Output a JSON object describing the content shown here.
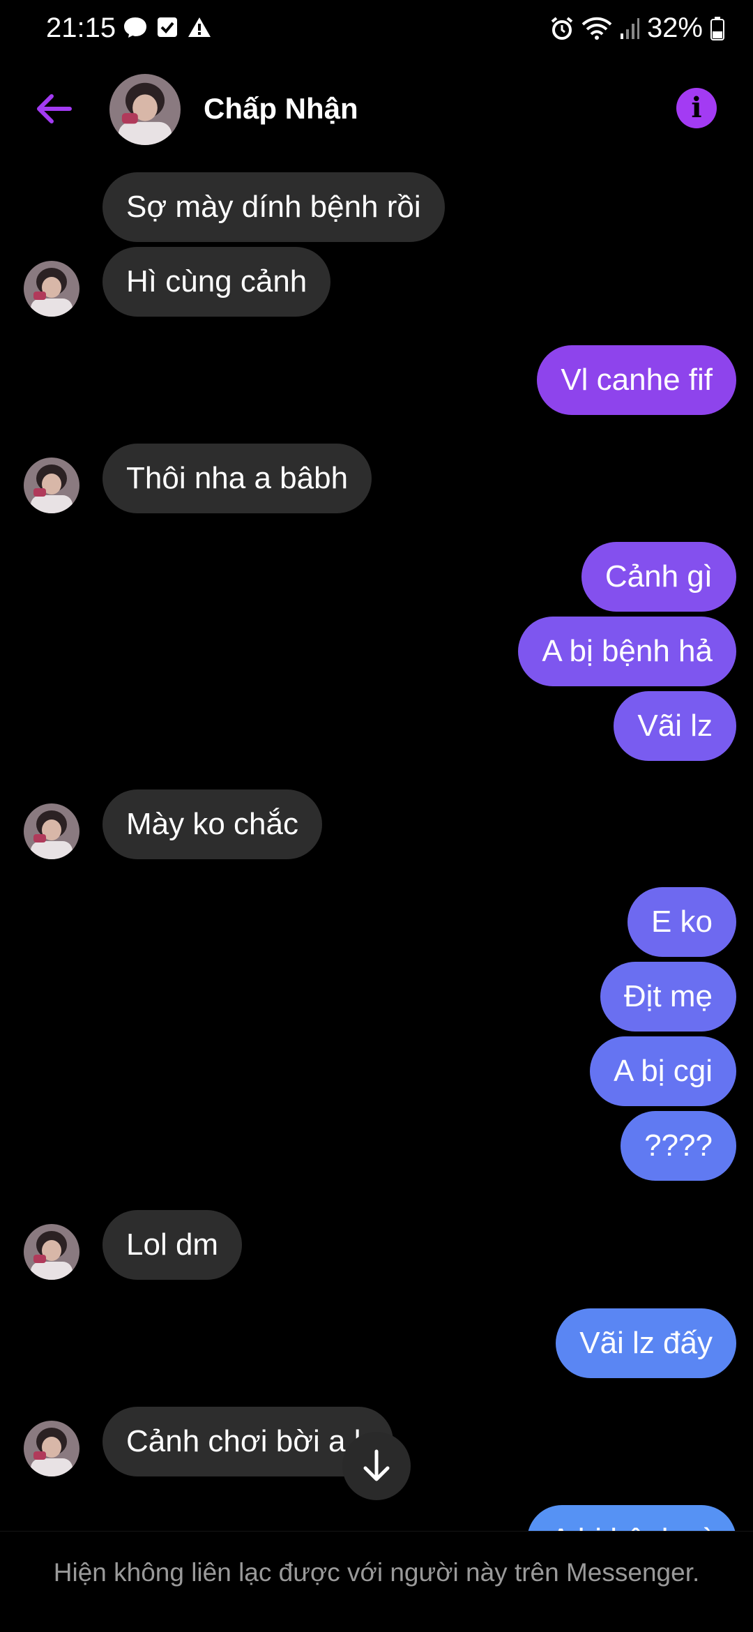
{
  "status_bar": {
    "time": "21:15",
    "battery_percent": "32%",
    "left_icons": [
      "messenger-bubble-icon",
      "checkbox-icon",
      "warning-icon"
    ],
    "right_icons": [
      "alarm-icon",
      "wifi-icon",
      "signal-icon",
      "battery-icon"
    ]
  },
  "header": {
    "contact_name": "Chấp Nhận",
    "back_icon": "arrow-left-icon",
    "info_icon": "info-icon",
    "accent_color": "#a33bf3"
  },
  "messages": [
    {
      "direction": "in",
      "text": "Sợ mày dính bệnh rồi",
      "show_avatar": false
    },
    {
      "direction": "in",
      "text": "Hì cùng cảnh",
      "show_avatar": true
    },
    {
      "direction": "out",
      "text": "Vl canhe fif",
      "color": "#8e44ec"
    },
    {
      "direction": "in",
      "text": "Thôi nha a bâbh",
      "show_avatar": true
    },
    {
      "direction": "out",
      "text": "Cảnh gì",
      "color": "#8450ee"
    },
    {
      "direction": "out",
      "text": "A bị bệnh hả",
      "color": "#7e56ef"
    },
    {
      "direction": "out",
      "text": "Vãi lz",
      "color": "#795cf0"
    },
    {
      "direction": "in",
      "text": "Mày ko chắc",
      "show_avatar": true
    },
    {
      "direction": "out",
      "text": "E ko",
      "color": "#6e69f0"
    },
    {
      "direction": "out",
      "text": "Địt mẹ",
      "color": "#6a6ff1"
    },
    {
      "direction": "out",
      "text": "A bị cgi",
      "color": "#6574f2"
    },
    {
      "direction": "out",
      "text": "????",
      "color": "#607af2"
    },
    {
      "direction": "in",
      "text": "Lol dm",
      "show_avatar": true
    },
    {
      "direction": "out",
      "text": "Vãi lz đấy",
      "color": "#5a86f3"
    },
    {
      "direction": "in",
      "text": "Cảnh chơi bời a k",
      "show_avatar": true
    },
    {
      "direction": "out",
      "text": "A bị bệnh gì",
      "color": "#5692f4"
    }
  ],
  "scroll_button_icon": "arrow-down-icon",
  "footer": {
    "notice": "Hiện không liên lạc được với người này trên Messenger."
  }
}
